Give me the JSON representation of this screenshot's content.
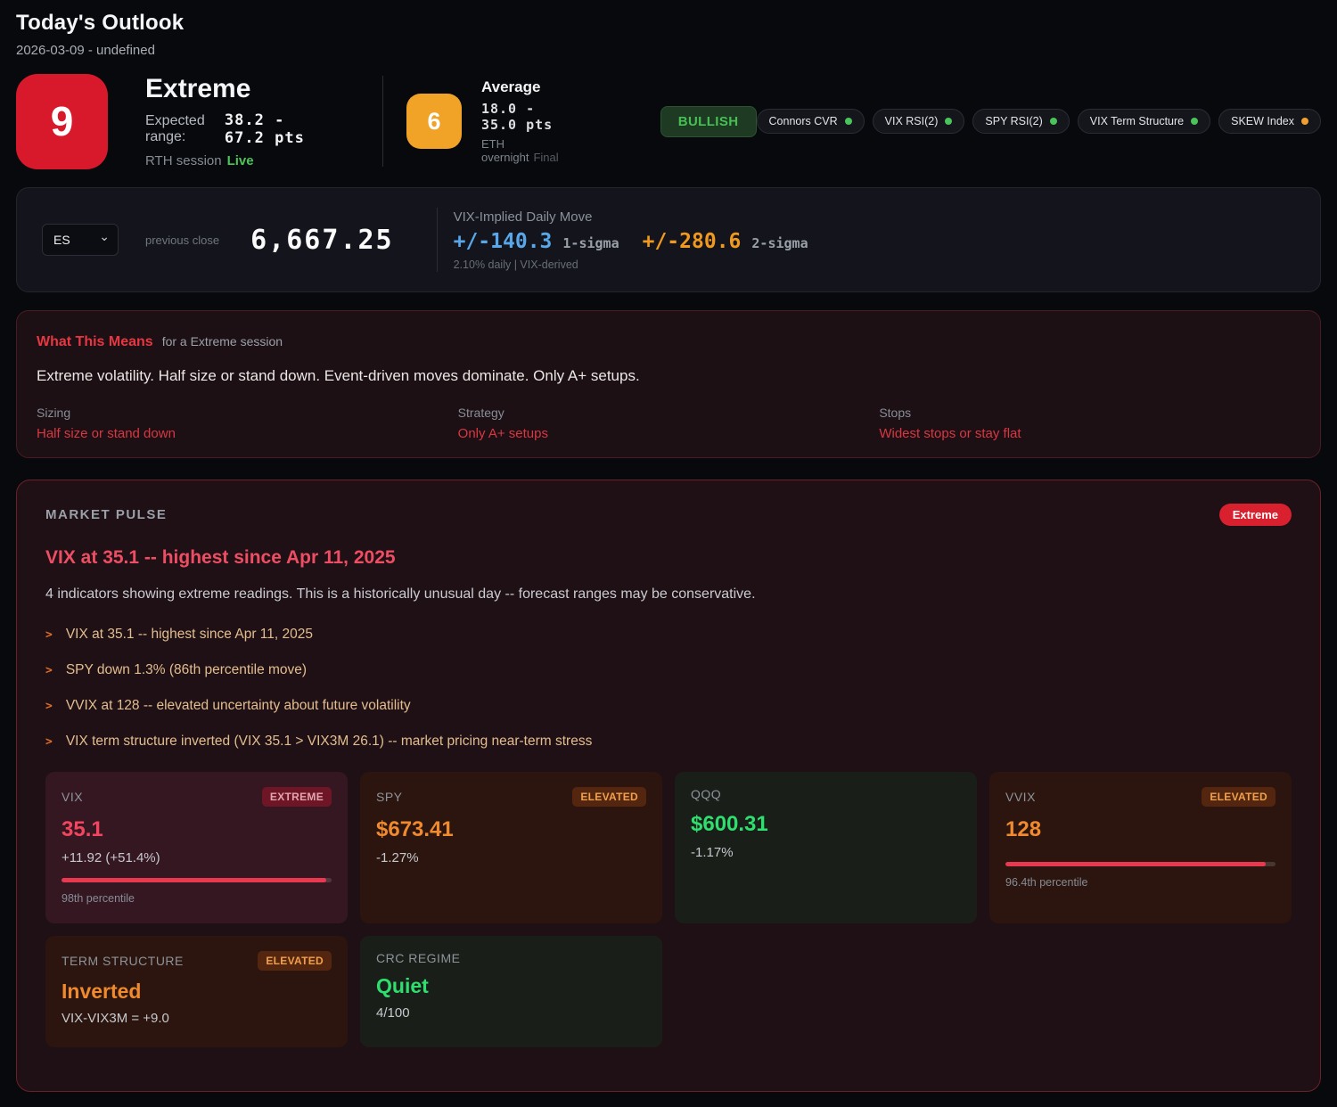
{
  "colors": {
    "score_red": "#d8192b",
    "score_amber": "#f0a326",
    "bullish_green": "#44c054",
    "sigma1_blue": "#58a7ea",
    "sigma2_orange": "#f0991e",
    "alert_red": "#e73742",
    "headline_pink": "#ee4e63",
    "progress_red": "#e83950",
    "dot_green": "#4cc35a",
    "dot_orange": "#f0a030"
  },
  "header": {
    "title": "Today's Outlook",
    "subtitle": "2026-03-09 - undefined"
  },
  "rth": {
    "score": "9",
    "label": "Extreme",
    "range_label": "Expected range:",
    "range_value": "38.2 - 67.2 pts",
    "session_label": "RTH session",
    "session_status": "Live"
  },
  "eth": {
    "score": "6",
    "label": "Average",
    "range_value": "18.0 - 35.0 pts",
    "session_label": "ETH overnight",
    "session_status": "Final"
  },
  "bias_badge": "BULLISH",
  "indicator_pills": [
    {
      "label": "Connors CVR",
      "dot_color": "#4cc35a"
    },
    {
      "label": "VIX RSI(2)",
      "dot_color": "#4cc35a"
    },
    {
      "label": "SPY RSI(2)",
      "dot_color": "#4cc35a"
    },
    {
      "label": "VIX Term Structure",
      "dot_color": "#4cc35a"
    },
    {
      "label": "SKEW Index",
      "dot_color": "#f0a030"
    }
  ],
  "price_row": {
    "symbol": "ES",
    "prev_close_label": "previous close",
    "prev_close": "6,667.25",
    "implied_title": "VIX-Implied Daily Move",
    "sigma1_value": "+/-140.3",
    "sigma1_label": "1-sigma",
    "sigma2_value": "+/-280.6",
    "sigma2_label": "2-sigma",
    "footnote": "2.10% daily | VIX-derived"
  },
  "what_this_means": {
    "title": "What This Means",
    "subtitle": "for a Extreme session",
    "body": "Extreme volatility. Half size or stand down. Event-driven moves dominate. Only A+ setups.",
    "columns": [
      {
        "label": "Sizing",
        "value": "Half size or stand down"
      },
      {
        "label": "Strategy",
        "value": "Only A+ setups"
      },
      {
        "label": "Stops",
        "value": "Widest stops or stay flat"
      }
    ]
  },
  "market_pulse": {
    "title": "MARKET PULSE",
    "badge": "Extreme",
    "headline": "VIX at 35.1 -- highest since Apr 11, 2025",
    "summary": "4 indicators showing extreme readings. This is a historically unusual day -- forecast ranges may be conservative.",
    "bullet_marker": ">",
    "bullets": [
      "VIX at 35.1 -- highest since Apr 11, 2025",
      "SPY down 1.3% (86th percentile move)",
      "VVIX at 128 -- elevated uncertainty about future volatility",
      "VIX term structure inverted (VIX 35.1 > VIX3M 26.1) -- market pricing near-term stress"
    ],
    "cards": [
      {
        "label": "VIX",
        "badge": "EXTREME",
        "value": "35.1",
        "change": "+11.92 (+51.4%)",
        "progress": 98,
        "footnote": "98th percentile"
      },
      {
        "label": "SPY",
        "badge": "ELEVATED",
        "value": "$673.41",
        "change": "-1.27%"
      },
      {
        "label": "QQQ",
        "value": "$600.31",
        "change": "-1.17%"
      },
      {
        "label": "VVIX",
        "badge": "ELEVATED",
        "value": "128",
        "progress": 96.4,
        "footnote": "96.4th percentile"
      },
      {
        "label": "TERM STRUCTURE",
        "badge": "ELEVATED",
        "value": "Inverted",
        "change": "VIX-VIX3M = +9.0"
      },
      {
        "label": "CRC REGIME",
        "value": "Quiet",
        "change": "4/100"
      }
    ]
  }
}
